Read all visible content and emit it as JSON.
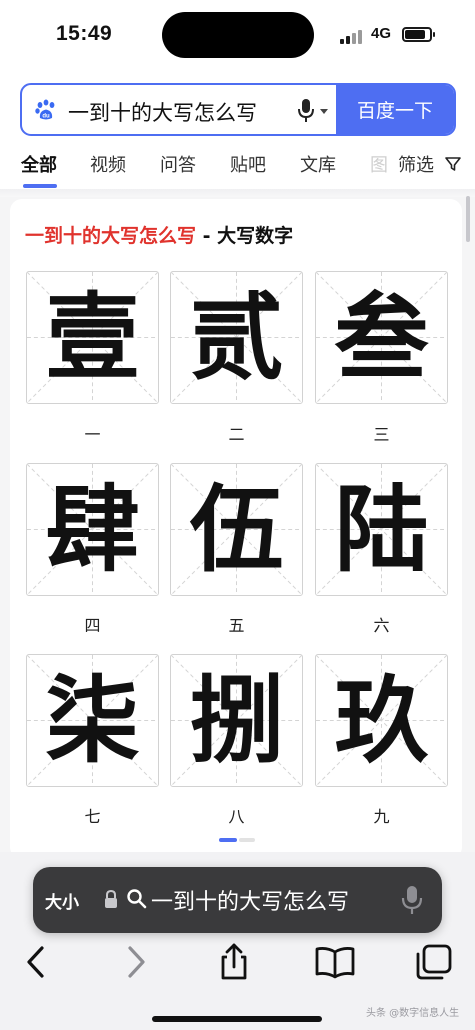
{
  "status_bar": {
    "time": "15:49",
    "network": "4G",
    "battery_level": 0.75
  },
  "search": {
    "query": "一到十的大写怎么写",
    "button_label": "百度一下"
  },
  "tabs": [
    {
      "label": "全部",
      "active": true
    },
    {
      "label": "视频"
    },
    {
      "label": "问答"
    },
    {
      "label": "贴吧"
    },
    {
      "label": "文库"
    },
    {
      "label": "图"
    }
  ],
  "filter_label": "筛选",
  "card": {
    "title_highlight": "一到十的大写怎么写",
    "title_rest": " - 大写数字",
    "characters": [
      {
        "big": "壹",
        "small": "一"
      },
      {
        "big": "贰",
        "small": "二"
      },
      {
        "big": "叁",
        "small": "三"
      },
      {
        "big": "肆",
        "small": "四"
      },
      {
        "big": "伍",
        "small": "五"
      },
      {
        "big": "陆",
        "small": "六"
      },
      {
        "big": "柒",
        "small": "七"
      },
      {
        "big": "捌",
        "small": "八"
      },
      {
        "big": "玖",
        "small": "九"
      }
    ],
    "page_index": 1,
    "page_count": 2
  },
  "address_bar": {
    "text_size_label": "大小",
    "url_text": "一到十的大写怎么写"
  },
  "watermark": "头条 @数字信息人生",
  "colors": {
    "accent": "#4e6ef2",
    "title_red": "#e0332d",
    "address_bar_bg": "#3a3a3c"
  },
  "icons": [
    "baidu-paw-icon",
    "microphone-icon",
    "dropdown-arrow-icon",
    "filter-funnel-icon",
    "lock-icon",
    "search-icon",
    "back-arrow-icon",
    "forward-arrow-icon",
    "share-icon",
    "bookmarks-book-icon",
    "tabs-icon"
  ]
}
